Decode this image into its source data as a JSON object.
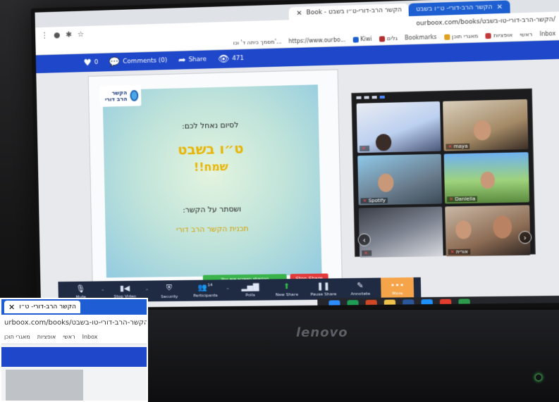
{
  "browser": {
    "tab_active_title": "הקשר הרב-דורי- ט״ו בשבט",
    "tab_other_title": "Book - הקשר הרב-דורי-ט״ו בשבט",
    "url": "ourboox.com/books/הקשר-הרב-דורי-טו-בשבט/",
    "bookmarks": [
      "Inbox",
      "ראשי",
      "אופציות",
      "מאגרי תוכן",
      "Bookmarks",
      "גלים",
      "Kiwi",
      "https://www.ourbo...",
      "מסמך כיתה ד' וכו'..."
    ]
  },
  "site_bar": {
    "likes": "0",
    "comments": "Comments (0)",
    "share": "Share",
    "views": "471"
  },
  "slide": {
    "logo": "הקשר הרב דורי",
    "line1": "לסיום נאחל לכם:",
    "line2": "ט״ו בשבט",
    "line3": "שמח!!",
    "line4": "ושסתר על הקשר:",
    "line5": "תכנית הקשר הרב דורי"
  },
  "share_banner": "You are screen sharing",
  "stop_share": "Stop Share",
  "gallery": {
    "participants": [
      {
        "name": ""
      },
      {
        "name": "maya"
      },
      {
        "name": "Spotify"
      },
      {
        "name": "Daniella"
      },
      {
        "name": ""
      },
      {
        "name": "אורית"
      }
    ]
  },
  "zoom_bar": {
    "mute": "Mute",
    "stop_video": "Stop Video",
    "security": "Security",
    "participants": "Participants",
    "participants_count": "14",
    "polls": "Polls",
    "new_share": "New Share",
    "pause_share": "Pause Share",
    "annotate": "Annotate",
    "more": "More"
  },
  "laptop_brand": "lenovo",
  "inset": {
    "tab_title": "הקשר הרב-דורי- ט״ו",
    "url": "urboox.com/books/הקשר-הרב-דורי-טו-בשבט/",
    "bookmarks": [
      "Inbox",
      "ראשי",
      "אופציות",
      "מאגרי תוכן"
    ]
  },
  "colors": {
    "site_blue": "#1e47c9",
    "slide_yellow": "#e8b400",
    "zoom_bar": "#1f2a43",
    "more_orange": "#f5a44a",
    "stop_red": "#e33b3b",
    "share_green": "#3ab34a"
  }
}
